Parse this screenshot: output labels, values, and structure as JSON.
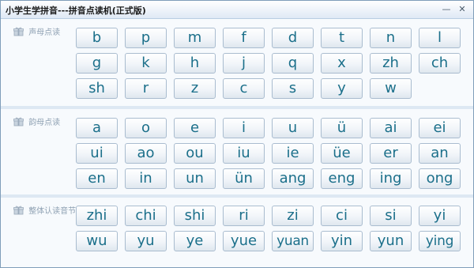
{
  "window": {
    "title": "小学生学拼音---拼音点读机(正式版)",
    "minimize_glyph": "—",
    "close_glyph": "✕"
  },
  "colors": {
    "key_text": "#1b6f8a",
    "section_label": "#8fa1b3"
  },
  "sections": [
    {
      "label": "声母点读",
      "icon": "gift-icon",
      "keys": [
        "b",
        "p",
        "m",
        "f",
        "d",
        "t",
        "n",
        "l",
        "g",
        "k",
        "h",
        "j",
        "q",
        "x",
        "zh",
        "ch",
        "sh",
        "r",
        "z",
        "c",
        "s",
        "y",
        "w"
      ]
    },
    {
      "label": "韵母点读",
      "icon": "gift-icon",
      "keys": [
        "a",
        "o",
        "e",
        "i",
        "u",
        "ü",
        "ai",
        "ei",
        "ui",
        "ao",
        "ou",
        "iu",
        "ie",
        "üe",
        "er",
        "an",
        "en",
        "in",
        "un",
        "ün",
        "ang",
        "eng",
        "ing",
        "ong"
      ]
    },
    {
      "label": "整体认读音节",
      "icon": "gift-icon",
      "keys": [
        "zhi",
        "chi",
        "shi",
        "ri",
        "zi",
        "ci",
        "si",
        "yi",
        "wu",
        "yu",
        "ye",
        "yue",
        "yuan",
        "yin",
        "yun",
        "ying"
      ]
    }
  ]
}
